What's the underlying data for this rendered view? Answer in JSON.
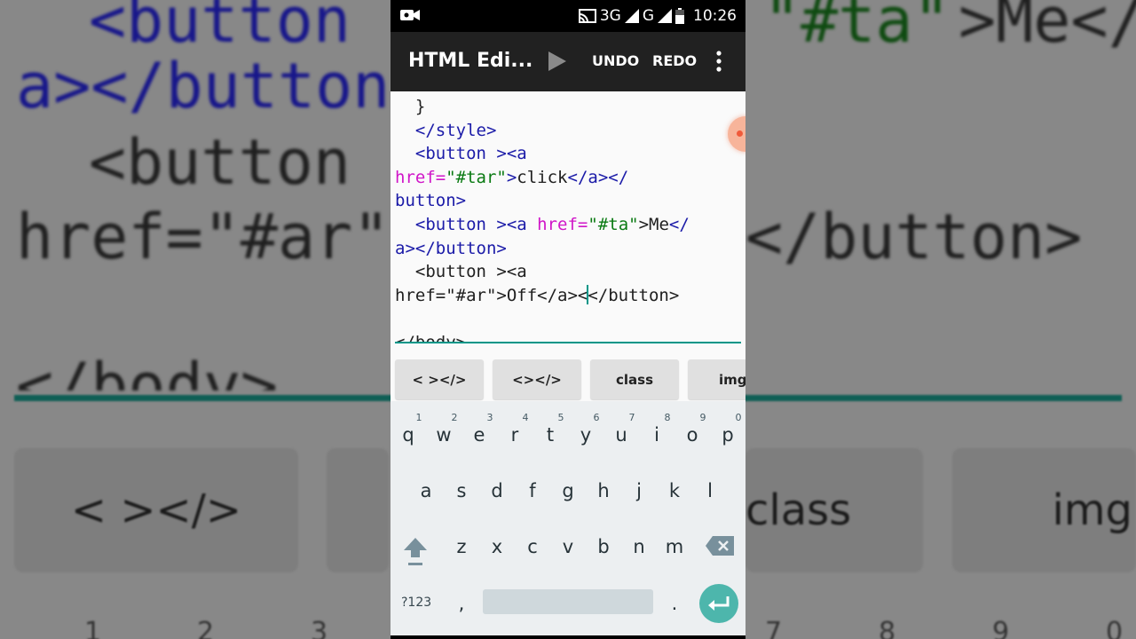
{
  "status_bar": {
    "network_1": "3G",
    "network_2": "G",
    "time": "10:26"
  },
  "toolbar": {
    "title": "HTML Edi...",
    "undo_label": "UNDO",
    "redo_label": "REDO"
  },
  "editor": {
    "line_brace": "}",
    "line_style_close": "</style>",
    "l1_open": "<button ><a",
    "l2_attr": "href=",
    "l2_val": "\"#tar\"",
    "l2_gt": ">",
    "l2_text": "click",
    "l2_close": "</a></",
    "l3_close": "button>",
    "l4_open": "<button ><a ",
    "l4_attr": "href=",
    "l4_val": "\"#ta\"",
    "l4_gt": ">",
    "l4_text": "Me",
    "l4_close": "</",
    "l5_close": "a></button>",
    "l6_open": "<button ><a",
    "l7_pre": "href=\"#ar\">Off</a><",
    "l7_post": "</button>",
    "l8_body": "</body>"
  },
  "snippets": [
    "< ></>",
    "<></>",
    "class",
    "img"
  ],
  "keyboard": {
    "row1": [
      "q",
      "w",
      "e",
      "r",
      "t",
      "y",
      "u",
      "i",
      "o",
      "p"
    ],
    "row1_hints": [
      "1",
      "2",
      "3",
      "4",
      "5",
      "6",
      "7",
      "8",
      "9",
      "0"
    ],
    "row2": [
      "a",
      "s",
      "d",
      "f",
      "g",
      "h",
      "j",
      "k",
      "l"
    ],
    "row3": [
      "z",
      "x",
      "c",
      "v",
      "b",
      "n",
      "m"
    ],
    "sym_label": "?123",
    "comma": ",",
    "period": "."
  },
  "background": {
    "row1_tag": "<button",
    "row1_val": "\"#ta\"",
    "row1_end": ">Me</",
    "row2": "a></button",
    "row3": "<button",
    "row4_left": "href=\"#ar\"",
    "row4_right": "</button>",
    "row5": "</body>",
    "key_left": "< ></>",
    "key_class": "class",
    "key_img": "img",
    "nums_left": [
      "1",
      "2",
      "3"
    ],
    "nums_right": [
      "7",
      "8",
      "9",
      "0"
    ]
  },
  "colors": {
    "accent": "#009688",
    "toolbar_bg": "#212121",
    "tag": "#1b1ba8",
    "attribute": "#d016c8",
    "string": "#0a7a12"
  }
}
